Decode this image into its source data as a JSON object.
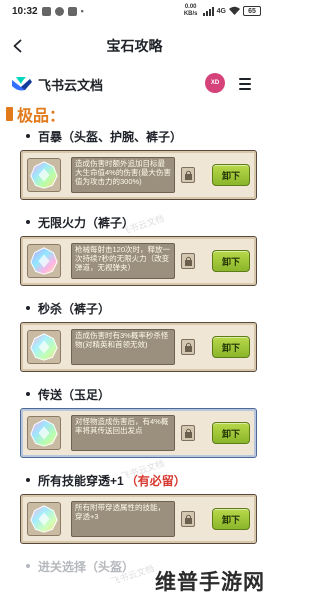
{
  "status_bar": {
    "time": "10:32",
    "network_speed": "0.00 KB/s",
    "network_type": "4G",
    "battery": "65"
  },
  "nav": {
    "back_icon": "back-arrow-icon",
    "title": "宝石攻略"
  },
  "doc": {
    "app_name": "飞书云文档",
    "avatar_text": "XD"
  },
  "section": {
    "title": "极品："
  },
  "items": [
    {
      "title": "百暴（头盔、护腕、裤子）",
      "desc": "造成伤害时额外追加目标最大生命值4%的伤害(最大伤害值为攻击力的300%)",
      "button": "卸下"
    },
    {
      "title": "无限火力（裤子）",
      "desc": "枪械每射击120次时，释放一次持续7秒的无限火力（改变弹道，无视弹夹）",
      "button": "卸下"
    },
    {
      "title": "秒杀（裤子）",
      "desc": "造成伤害时有3%概率秒杀怪物(对精英和首领无效)",
      "button": "卸下"
    },
    {
      "title": "传送（玉足）",
      "desc": "对怪物造成伤害后，有4%概率将其传送回出发点",
      "button": "卸下"
    },
    {
      "title": "所有技能穿透+1",
      "title_highlight": "（有必留）",
      "desc": "所有附带穿透属性的技能，穿透+3",
      "button": "卸下"
    }
  ],
  "next_item": {
    "title": "进关选择（头盔）"
  },
  "watermarks": [
    "飞书云文档",
    "飞书云文档",
    "飞书云文档",
    "飞书云文档"
  ],
  "brand_watermark": "维普手游网",
  "colors": {
    "accent_orange": "#e07a1b",
    "highlight_red": "#d7382f",
    "button_green": "#8bb52b"
  }
}
